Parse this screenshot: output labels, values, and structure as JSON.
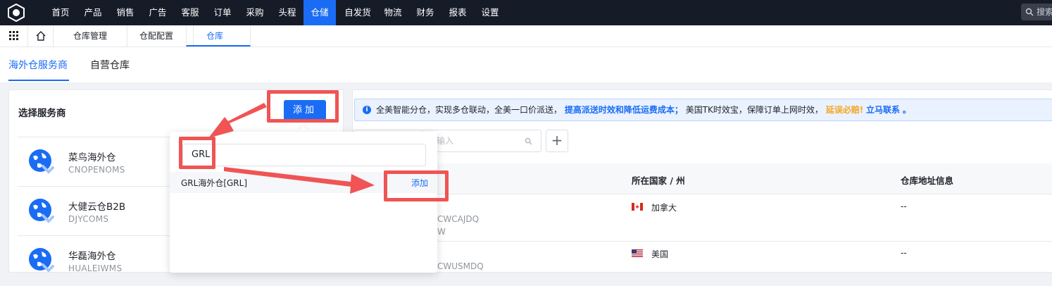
{
  "nav": {
    "items": [
      "首页",
      "产品",
      "销售",
      "广告",
      "客服",
      "订单",
      "采购",
      "头程",
      "仓储",
      "自发货",
      "物流",
      "财务",
      "报表",
      "设置"
    ],
    "active_index": 8,
    "search_placeholder": "搜索"
  },
  "tabbar": {
    "tabs": [
      "仓库管理",
      "仓配配置",
      "仓库设置"
    ],
    "active_index": 2
  },
  "subtabs": {
    "items": [
      "海外仓服务商",
      "自营仓库"
    ],
    "active_index": 0
  },
  "left_panel": {
    "title": "选择服务商",
    "add_button": "添加",
    "providers": [
      {
        "name": "菜鸟海外仓",
        "code": "CNOPENOMS"
      },
      {
        "name": "大健云仓B2B",
        "code": "DJYCOMS"
      },
      {
        "name": "华磊海外仓",
        "code": "HUALEIWMS"
      }
    ]
  },
  "notice": {
    "part1": "全美智能分仓，实现多仓联动，全美一口价派送，",
    "highlight1": "提高派送时效和降低运费成本；",
    "part2": "美国TK时效宝，保障订单上网时效，",
    "highlight2": "延误必赔!",
    "highlight3": "立马联系",
    "end": "。"
  },
  "filter": {
    "input_placeholder": "输入",
    "plus": "+"
  },
  "table": {
    "headers": [
      "所在国家 / 州",
      "仓库地址信息"
    ],
    "rows": [
      {
        "code_fragment": "CWCAJDQ",
        "code_fragment2": "W",
        "country": "加拿大",
        "address": "--"
      },
      {
        "code_fragment": "CWUSMDQ",
        "country": "美国",
        "address": "--"
      }
    ]
  },
  "popover": {
    "input_value": "GRL",
    "result_label": "GRL海外仓[GRL]",
    "result_action": "添加"
  },
  "colors": {
    "accent": "#1a6cf5",
    "nav_bg": "#161b28",
    "annotation_red": "#f05454",
    "warning": "#f5a623"
  }
}
